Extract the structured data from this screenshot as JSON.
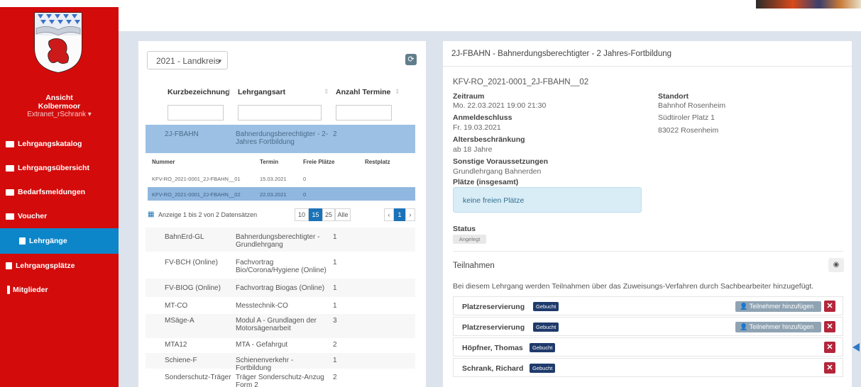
{
  "sidebar": {
    "user": {
      "line1": "Ansicht",
      "line2": "Kolbermoor",
      "line3": "Extranet_rSchrank ▾"
    },
    "items": [
      {
        "label": "Lehrgangskatalog",
        "icon": "card-icon"
      },
      {
        "label": "Lehrgangsübersicht",
        "icon": "card-icon"
      },
      {
        "label": "Bedarfsmeldungen",
        "icon": "clipboard-icon"
      },
      {
        "label": "Voucher",
        "icon": "envelope-icon"
      },
      {
        "label": "Lehrgänge",
        "icon": "calendar-icon",
        "active": true
      },
      {
        "label": "Lehrgangsplätze",
        "icon": "calendar-icon"
      },
      {
        "label": "Mitglieder",
        "icon": "person-icon"
      }
    ],
    "colors": {
      "background": "#d40b0b",
      "active": "#0d86c9"
    }
  },
  "left": {
    "year_select": "2021 - Landkreis",
    "columns": [
      "Kurzbezeichnung",
      "Lehrgangsart",
      "Anzahl Termine"
    ],
    "selected_row": {
      "kurz": "2J-FBAHN",
      "art": "Bahnerdungsberechtigter - 2-Jahres Fortbildung",
      "anzahl": "2"
    },
    "nested": {
      "columns": [
        "Nummer",
        "Termin",
        "Freie Plätze",
        "Restplatz"
      ],
      "rows": [
        {
          "nummer": "KFV-RO_2021-0001_2J-FBAHN__01",
          "termin": "15.03.2021",
          "frei": "0"
        },
        {
          "nummer": "KFV-RO_2021-0001_2J-FBAHN__02",
          "termin": "22.03.2021",
          "frei": "0"
        }
      ],
      "info": "Anzeige 1 bis 2 von 2 Datensätzen",
      "sizes": [
        "10",
        "15",
        "25",
        "Alle"
      ],
      "pages": [
        "‹",
        "1",
        "›"
      ]
    },
    "rows": [
      {
        "kurz": "BahnErd-GL",
        "art": "Bahnerdungsberechtigter - Grundlehrgang",
        "anzahl": "1"
      },
      {
        "kurz": "FV-BCH (Online)",
        "art": "Fachvortrag Bio/Corona/Hygiene (Online)",
        "anzahl": "1"
      },
      {
        "kurz": "FV-BIOG (Online)",
        "art": "Fachvortrag Biogas (Online)",
        "anzahl": "1"
      },
      {
        "kurz": "MT-CO",
        "art": "Messtechnik-CO",
        "anzahl": "1"
      },
      {
        "kurz": "MSäge-A",
        "art": "Modul A - Grundlagen der Motorsägenarbeit",
        "anzahl": "3"
      },
      {
        "kurz": "MTA12",
        "art": "MTA - Gefahrgut",
        "anzahl": "2"
      },
      {
        "kurz": "Schiene-F",
        "art": "Schienenverkehr - Fortbildung",
        "anzahl": "1"
      },
      {
        "kurz": "Sonderschutz-Träger",
        "art": "Träger Sonderschutz-Anzug Form 2",
        "anzahl": "2"
      }
    ]
  },
  "right": {
    "header": "2J-FBAHN - Bahnerdungsberechtigter - 2 Jahres-Fortbildung",
    "code": "KFV-RO_2021-0001_2J-FBAHN__02",
    "zeitraum_label": "Zeitraum",
    "zeitraum": "Mo. 22.03.2021 19:00 21:30",
    "anmeldeschluss_label": "Anmeldeschluss",
    "anmeldeschluss": "Fr. 19.03.2021",
    "alter_label": "Altersbeschränkung",
    "alter": "ab 18 Jahre",
    "sonstige_label": "Sonstige Voraussetzungen",
    "sonstige": "Grundlehrgang Bahnerden",
    "plaetze_label": "Plätze (insgesamt)",
    "plaetze_info": "keine freien Plätze",
    "standort_label": "Standort",
    "standort": [
      "Bahnhof Rosenheim",
      "Südtiroler Platz 1",
      "83022 Rosenheim"
    ],
    "status_label": "Status",
    "status": "Angelegt",
    "teilnahmen_title": "Teilnahmen",
    "teilnahmen_desc": "Bei diesem Lehrgang werden Teilnahmen über das Zuweisungs-Verfahren durch Sachbearbeiter hinzugefügt.",
    "gebucht": "Gebucht",
    "add_label": "Teilnehmer hinzufügen",
    "slots": [
      "Platzreservierung",
      "Platzreservierung",
      "Höpfner, Thomas",
      "Schrank, Richard"
    ]
  }
}
